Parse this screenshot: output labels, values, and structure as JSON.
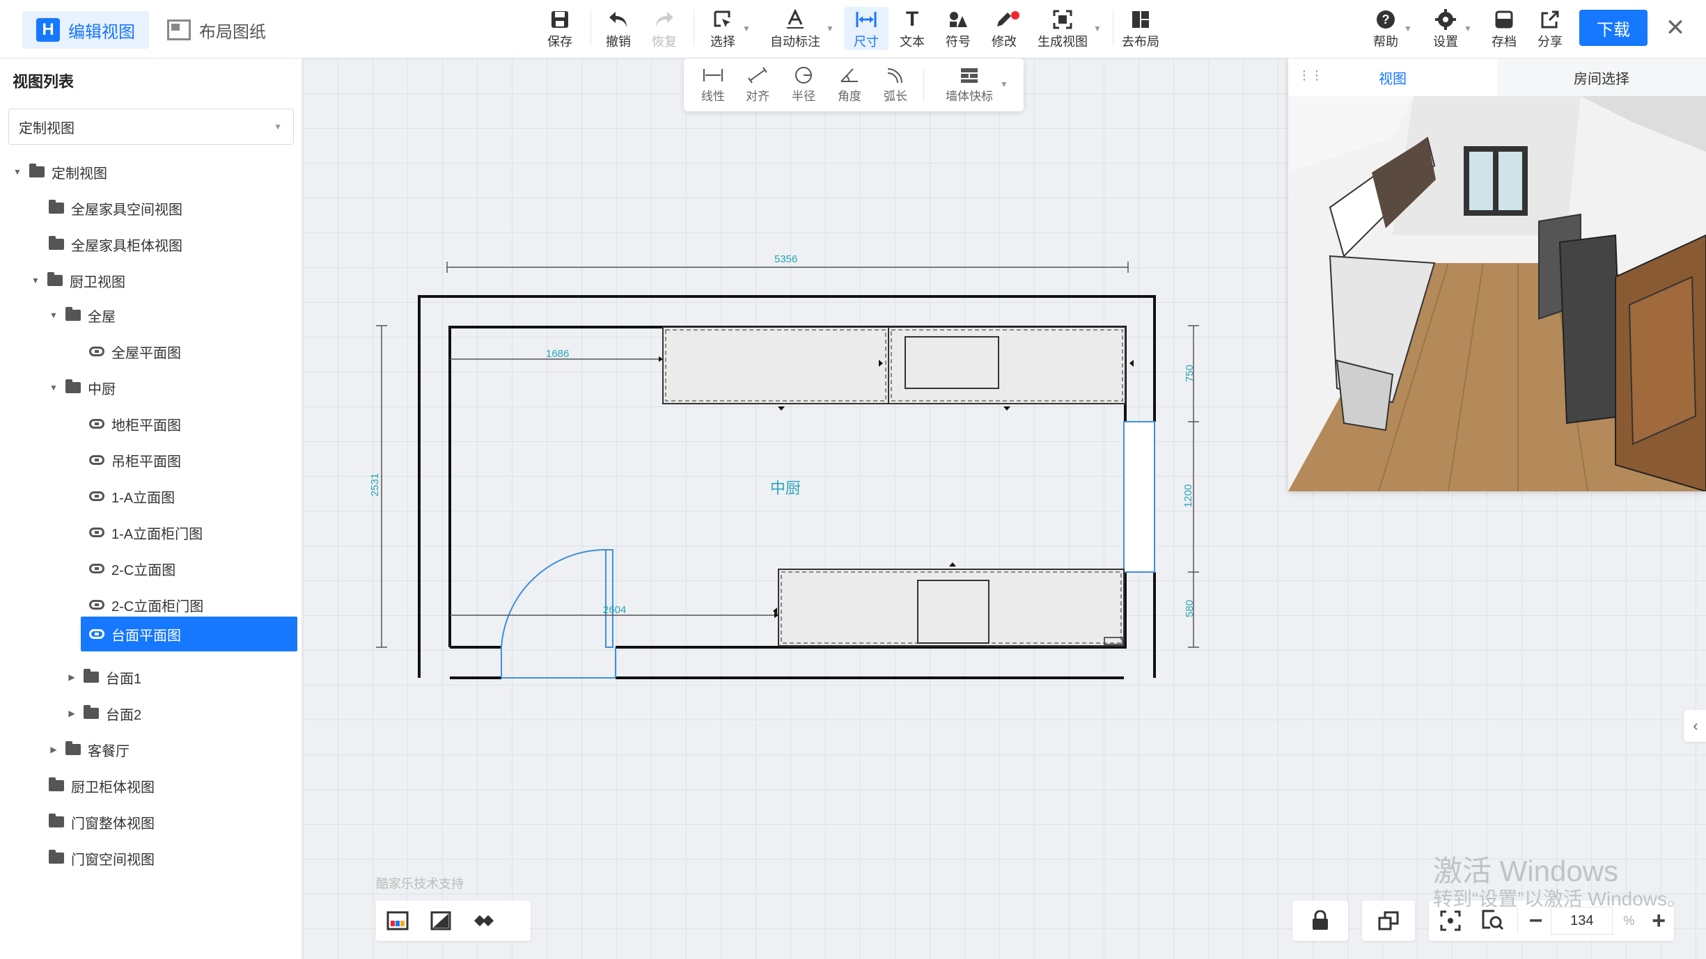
{
  "header": {
    "mode_tabs": [
      {
        "label": "编辑视图"
      },
      {
        "label": "布局图纸"
      }
    ],
    "tools": [
      {
        "label": "保存",
        "icon": "save-icon"
      },
      {
        "label": "撤销",
        "icon": "undo-icon"
      },
      {
        "label": "恢复",
        "icon": "redo-icon"
      },
      {
        "label": "选择",
        "icon": "select-icon"
      },
      {
        "label": "自动标注",
        "icon": "auto-annotate-icon"
      },
      {
        "label": "尺寸",
        "icon": "dimension-icon"
      },
      {
        "label": "文本",
        "icon": "text-icon"
      },
      {
        "label": "符号",
        "icon": "symbol-icon"
      },
      {
        "label": "修改",
        "icon": "edit-icon"
      },
      {
        "label": "生成视图",
        "icon": "generate-view-icon"
      },
      {
        "label": "去布局",
        "icon": "go-layout-icon"
      }
    ],
    "right_tools": [
      {
        "label": "帮助",
        "icon": "help-icon"
      },
      {
        "label": "设置",
        "icon": "settings-icon"
      },
      {
        "label": "存档",
        "icon": "archive-icon"
      },
      {
        "label": "分享",
        "icon": "share-icon"
      }
    ],
    "download_label": "下载"
  },
  "subtoolbar": {
    "items": [
      {
        "label": "线性"
      },
      {
        "label": "对齐"
      },
      {
        "label": "半径"
      },
      {
        "label": "角度"
      },
      {
        "label": "弧长"
      },
      {
        "label": "墙体快标"
      }
    ]
  },
  "sidebar": {
    "title": "视图列表",
    "select_value": "定制视图",
    "tree": [
      {
        "label": "定制视图"
      },
      {
        "label": "全屋家具空间视图"
      },
      {
        "label": "全屋家具柜体视图"
      },
      {
        "label": "厨卫视图"
      },
      {
        "label": "全屋"
      },
      {
        "label": "全屋平面图"
      },
      {
        "label": "中厨"
      },
      {
        "label": "地柜平面图"
      },
      {
        "label": "吊柜平面图"
      },
      {
        "label": "1-A立面图"
      },
      {
        "label": "1-A立面柜门图"
      },
      {
        "label": "2-C立面图"
      },
      {
        "label": "2-C立面柜门图"
      },
      {
        "label": "台面平面图"
      },
      {
        "label": "台面1"
      },
      {
        "label": "台面2"
      },
      {
        "label": "客餐厅"
      },
      {
        "label": "厨卫柜体视图"
      },
      {
        "label": "门窗整体视图"
      },
      {
        "label": "门窗空间视图"
      }
    ]
  },
  "drawing": {
    "room_label": "中厨",
    "dims": {
      "total_width": "5356",
      "top_run": "1686",
      "bottom_run": "2604",
      "height": "2531",
      "right_top": "750",
      "right_mid": "1200",
      "right_bottom": "580"
    }
  },
  "preview": {
    "tabs": [
      {
        "label": "视图"
      },
      {
        "label": "房间选择"
      }
    ]
  },
  "footer": {
    "credit": "酷家乐技术支持",
    "zoom_value": "134",
    "zoom_unit": "%",
    "watermark_line1": "激活 Windows",
    "watermark_line2": "转到“设置”以激活 Windows。"
  },
  "colors": {
    "accent": "#1677ff",
    "dim_text": "#2aa6b8",
    "door": "#3d8fe0"
  }
}
